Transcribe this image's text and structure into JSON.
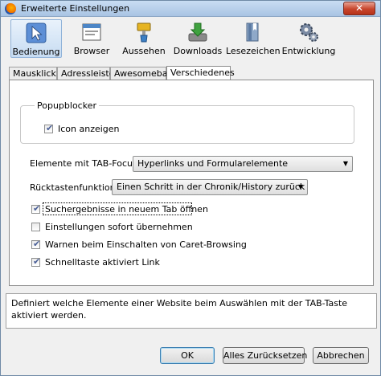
{
  "window": {
    "title": "Erweiterte Einstellungen",
    "close_label": "✕"
  },
  "toolbar": {
    "items": [
      {
        "label": "Bedienung",
        "icon": "cursor-icon",
        "active": true
      },
      {
        "label": "Browser",
        "icon": "browser-window-icon"
      },
      {
        "label": "Aussehen",
        "icon": "paint-brush-icon"
      },
      {
        "label": "Downloads",
        "icon": "download-arrow-icon"
      },
      {
        "label": "Lesezeichen",
        "icon": "bookmarks-icon"
      },
      {
        "label": "Entwicklung",
        "icon": "gears-icon"
      }
    ]
  },
  "tabs": [
    {
      "label": "Mausklick"
    },
    {
      "label": "Adressleiste"
    },
    {
      "label": "Awesomebar"
    },
    {
      "label": "Verschiedenes",
      "active": true
    }
  ],
  "popupblocker": {
    "title": "Popupblocker",
    "icon_checkbox": {
      "label": "Icon anzeigen",
      "checked": true
    }
  },
  "tab_focus": {
    "label": "Elemente mit TAB-Focus",
    "value": "Hyperlinks und Formularelemente"
  },
  "backspace": {
    "label": "Rücktastenfunktion",
    "value": "Einen Schritt in der Chronik/History zurück"
  },
  "options": [
    {
      "label": "Suchergebnisse in neuem Tab öffnen",
      "checked": true
    },
    {
      "label": "Einstellungen sofort übernehmen",
      "checked": false
    },
    {
      "label": "Warnen beim Einschalten von Caret-Browsing",
      "checked": true
    },
    {
      "label": "Schnelltaste aktiviert Link",
      "checked": true
    }
  ],
  "description": "Definiert welche Elemente einer Website beim Auswählen mit der TAB-Taste aktiviert werden.",
  "buttons": {
    "ok": "OK",
    "reset": "Alles Zurücksetzen",
    "cancel": "Abbrechen"
  },
  "check_glyph": "✔",
  "arrow_glyph": "▼"
}
